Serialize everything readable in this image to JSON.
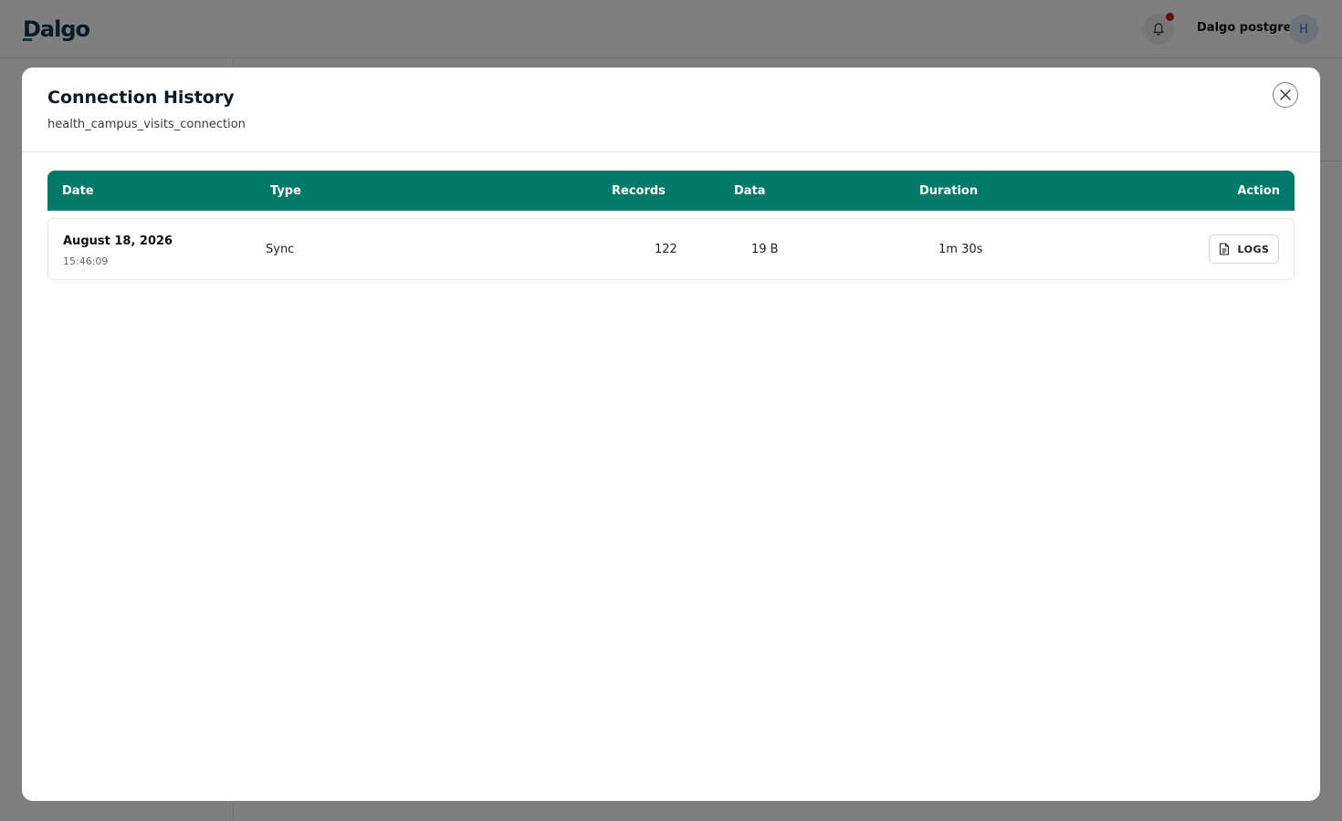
{
  "app": {
    "logo_text": "Dalgo",
    "user_name": "Dalgo postgres",
    "avatar_initial": "H"
  },
  "modal": {
    "title": "Connection History",
    "subtitle": "health_campus_visits_connection"
  },
  "table": {
    "columns": [
      "Date",
      "Type",
      "Records",
      "Data",
      "Duration",
      "Action"
    ],
    "rows": [
      {
        "date": "August 18, 2026",
        "time": "15:46:09",
        "type": "Sync",
        "records": "122",
        "data": "19 B",
        "duration": "1m 30s",
        "action_label": "LOGS"
      }
    ]
  },
  "icons": {
    "notification": "bell-icon",
    "close": "close-icon",
    "logs": "document-icon"
  },
  "colors": {
    "table_header": "#00796b",
    "notification_dot": "#d01818",
    "brand": "#12364a"
  }
}
